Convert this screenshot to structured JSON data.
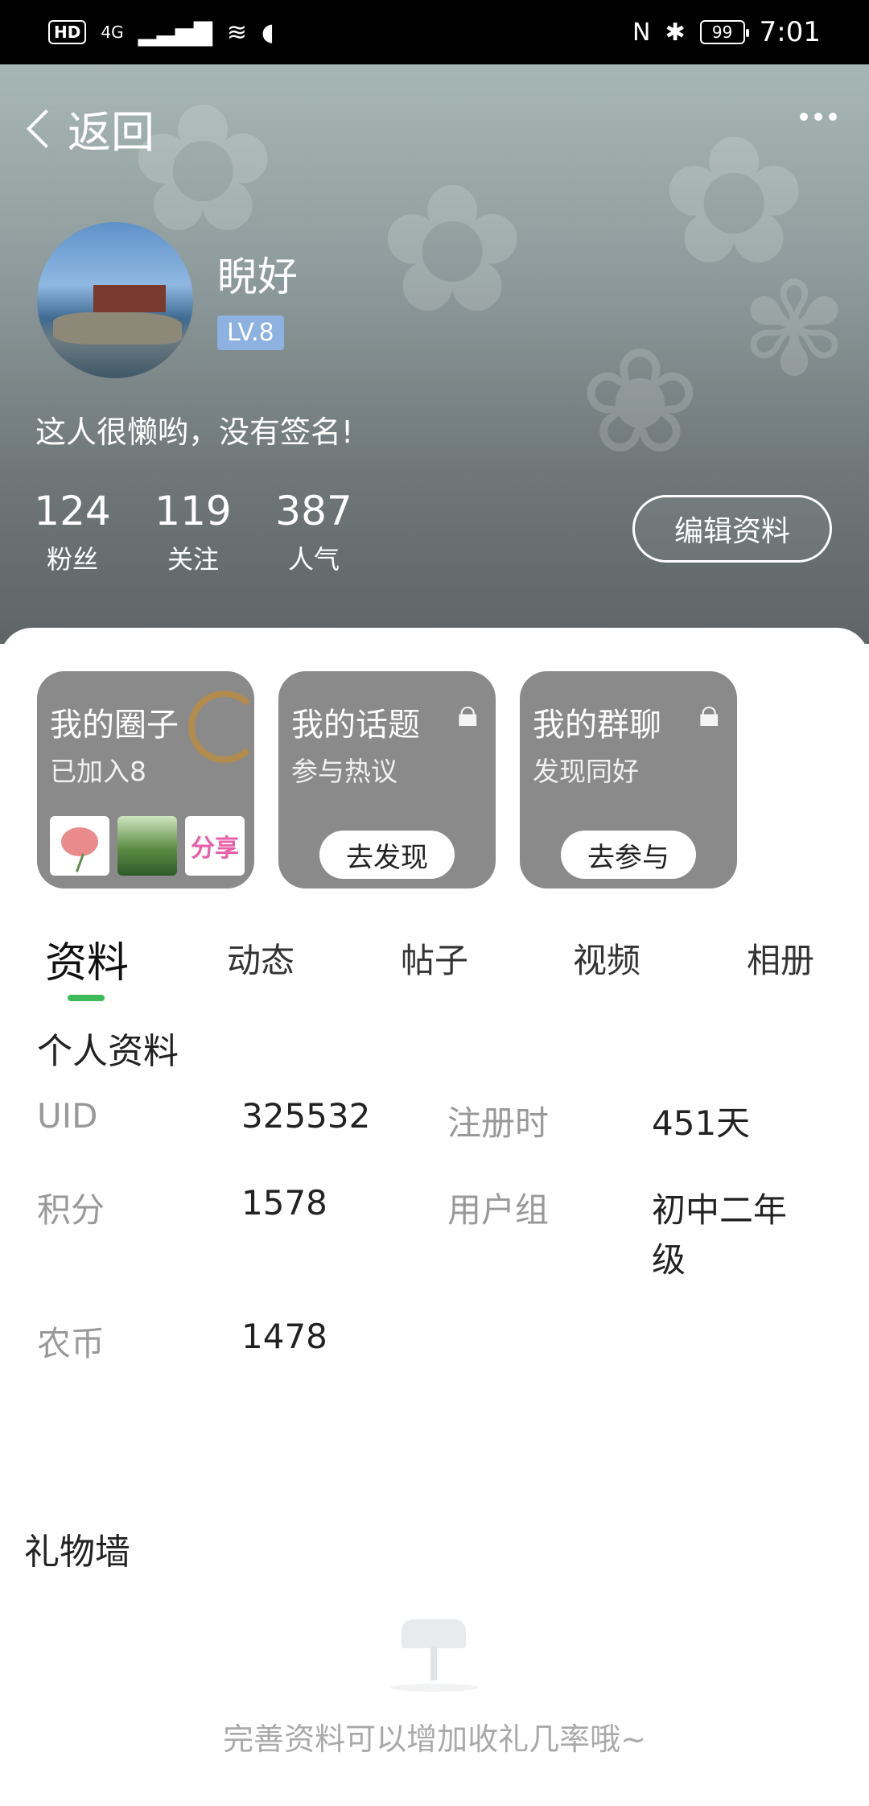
{
  "status_bar": {
    "hd": "HD",
    "network": "4G",
    "battery": "99",
    "time": "7:01"
  },
  "nav": {
    "back_label": "返回"
  },
  "profile": {
    "name": "睨好",
    "level": "LV.8",
    "signature": "这人很懒哟，没有签名!",
    "stats": [
      {
        "value": "124",
        "label": "粉丝"
      },
      {
        "value": "119",
        "label": "关注"
      },
      {
        "value": "387",
        "label": "人气"
      }
    ],
    "edit_label": "编辑资料"
  },
  "cards": [
    {
      "title": "我的圈子",
      "subtitle": "已加入8",
      "thumbs": [
        "flower",
        "garden",
        "分享"
      ]
    },
    {
      "title": "我的话题",
      "subtitle": "参与热议",
      "button": "去发现"
    },
    {
      "title": "我的群聊",
      "subtitle": "发现同好",
      "button": "去参与"
    }
  ],
  "tabs": [
    "资料",
    "动态",
    "帖子",
    "视频",
    "相册"
  ],
  "active_tab": "资料",
  "info": {
    "title": "个人资料",
    "uid_label": "UID",
    "uid_value": "325532",
    "reg_label": "注册时",
    "reg_value": "451天",
    "points_label": "积分",
    "points_value": "1578",
    "group_label": "用户组",
    "group_value_line1": "初中二年",
    "group_value_line2": "级",
    "coins_label": "农币",
    "coins_value": "1478"
  },
  "gifts": {
    "title": "礼物墙",
    "empty_text": "完善资料可以增加收礼几率哦~"
  },
  "colors": {
    "accent": "#3fba5a",
    "level_badge": "#8db1e0",
    "card_bg": "#8a8a8a"
  }
}
